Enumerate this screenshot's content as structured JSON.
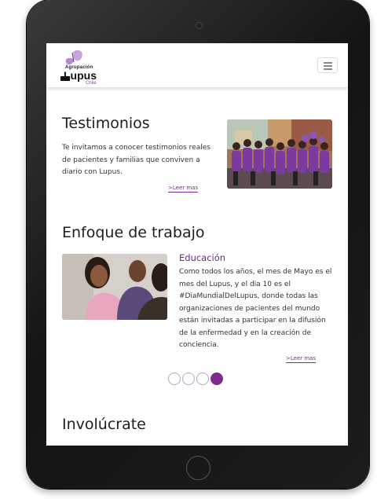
{
  "header": {
    "logo_line1": "Agrupación",
    "logo_line2": "Lupus",
    "logo_line3": "Chile",
    "menu_label": "menu"
  },
  "testimonios": {
    "title": "Testimonios",
    "body": "Te invitamos a conocer testimonios reales de pacientes y familias que conviven a diario con Lupus.",
    "more": ">Leer mas"
  },
  "enfoque": {
    "title": "Enfoque de trabajo",
    "slide_title": "Educación",
    "slide_body": "Como todos los años, el mes de Mayo es el mes del Lupus, y el dia 10 es el #DiaMundialDelLupus, donde todas las organizaciones de pacientes del mundo están invitadas a participar en la difusión de la enfermedad y en la creación de conciencia.",
    "more": ">Leer mas",
    "slides_total": 4,
    "active_slide": 4
  },
  "involucrate": {
    "title": "Involúcrate"
  },
  "colors": {
    "accent": "#7b2c8c",
    "heading": "#1e1e1e"
  }
}
